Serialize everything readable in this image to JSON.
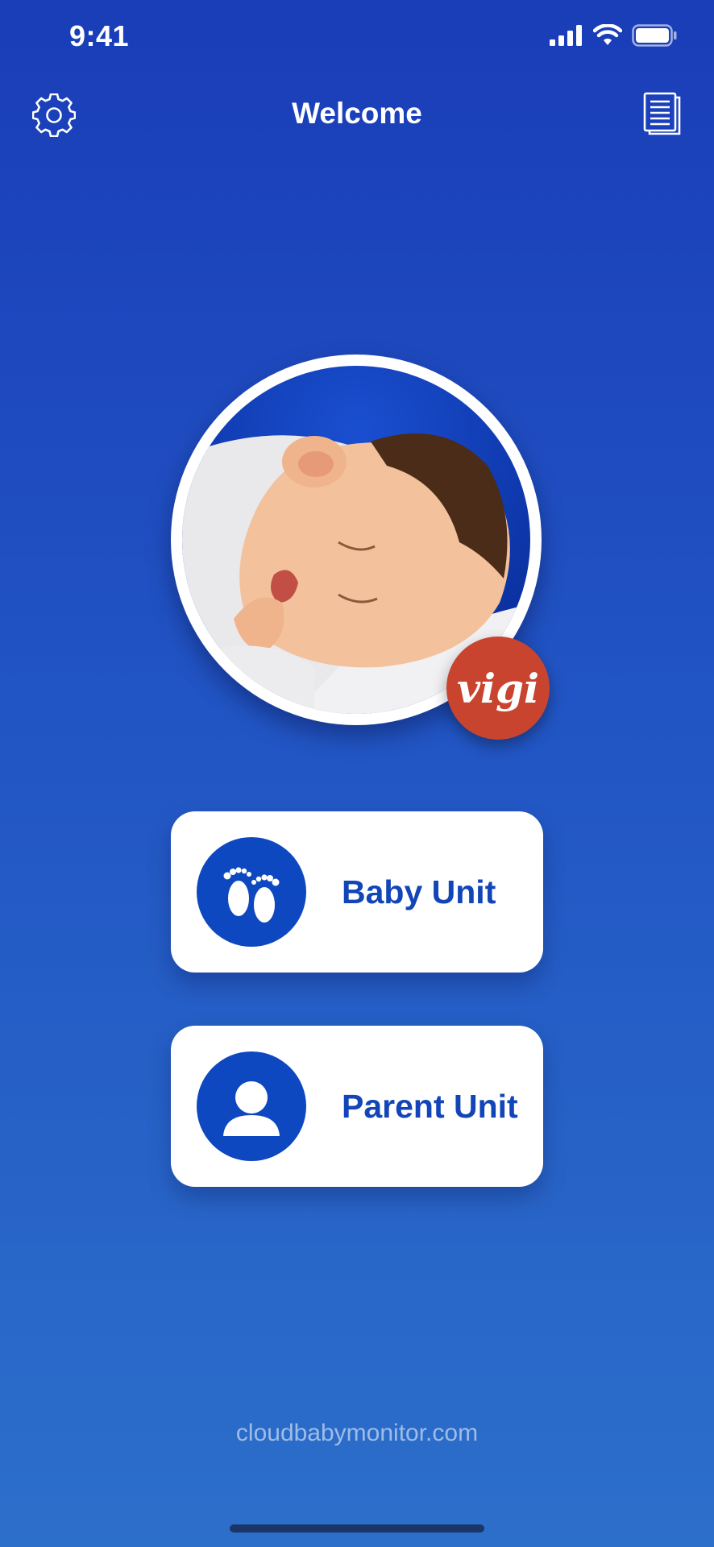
{
  "status_bar": {
    "time": "9:41"
  },
  "nav": {
    "title": "Welcome"
  },
  "badge": {
    "text": "vigi"
  },
  "units": {
    "baby_label": "Baby Unit",
    "parent_label": "Parent Unit"
  },
  "footer": {
    "link_text": "cloudbabymonitor.com"
  },
  "icons": {
    "settings": "gear-icon",
    "docs": "document-icon",
    "baby": "baby-feet-icon",
    "parent": "person-icon"
  },
  "colors": {
    "background_top": "#1a3db8",
    "background_bottom": "#2c6fca",
    "accent": "#0d48c0",
    "badge": "#c9442e"
  }
}
